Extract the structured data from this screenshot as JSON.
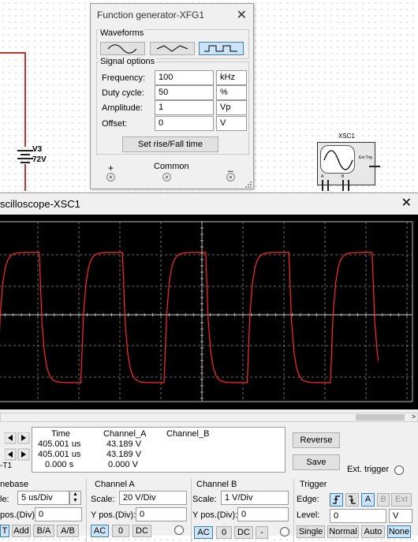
{
  "schematic": {
    "battery_ref": "V3",
    "battery_value": "72V",
    "scope_ref": "XSC1",
    "scope_ext_trig": "Ext Trig",
    "scope_pin_a": "A",
    "scope_pin_b": "B"
  },
  "function_generator": {
    "title": "Function generator-XFG1",
    "close": "✕",
    "waveforms_label": "Waveforms",
    "waveform_buttons": [
      "sine-wave-icon",
      "triangle-wave-icon",
      "square-wave-icon"
    ],
    "selected_waveform": "square",
    "signal_options_label": "Signal options",
    "frequency": {
      "label": "Frequency:",
      "value": "100",
      "unit": "kHz"
    },
    "duty_cycle": {
      "label": "Duty cycle:",
      "value": "50",
      "unit": "%"
    },
    "amplitude": {
      "label": "Amplitude:",
      "value": "1",
      "unit": "Vp"
    },
    "offset": {
      "label": "Offset:",
      "value": "0",
      "unit": "V"
    },
    "rise_fall_button": "Set rise/Fall time",
    "plus_label": "+",
    "common_label": "Common",
    "minus_label": "_"
  },
  "oscilloscope": {
    "title": "scilloscope-XSC1",
    "close": "✕",
    "trace_color": "#ff2a2a",
    "readout": {
      "headers": [
        "Time",
        "Channel_A",
        "Channel_B"
      ],
      "rows": [
        [
          "405.001 us",
          "43.189 V",
          ""
        ],
        [
          "405.001 us",
          "43.189 V",
          ""
        ],
        [
          "0.000 s",
          "0.000 V",
          ""
        ]
      ]
    },
    "t1_label": "T1",
    "t2_label": "-T1",
    "reverse_button": "Reverse",
    "save_button": "Save",
    "ext_trigger_label": "Ext. trigger",
    "timebase": {
      "label": "nebase",
      "scale_label": "le:",
      "scale_value": "5 us/Div",
      "xpos_label": "pos.(Div):",
      "xpos_value": "0",
      "buttons": [
        "T",
        "Add",
        "B/A",
        "A/B"
      ]
    },
    "channel_a": {
      "label": "Channel A",
      "scale_label": "Scale:",
      "scale_value": "20  V/Div",
      "ypos_label": "Y pos.(Div):",
      "ypos_value": "0",
      "buttons": [
        "AC",
        "0",
        "DC"
      ]
    },
    "channel_b": {
      "label": "Channel B",
      "scale_label": "Scale:",
      "scale_value": "1  V/Div",
      "ypos_label": "Y pos.(Div):",
      "ypos_value": "0",
      "buttons": [
        "AC",
        "0",
        "DC",
        "-"
      ]
    },
    "trigger": {
      "label": "Trigger",
      "edge_label": "Edge:",
      "edge_buttons": [
        "A",
        "B",
        "Ext"
      ],
      "level_label": "Level:",
      "level_value": "0",
      "level_unit": "V",
      "mode_buttons": [
        "Single",
        "Normal",
        "Auto",
        "None"
      ]
    }
  }
}
